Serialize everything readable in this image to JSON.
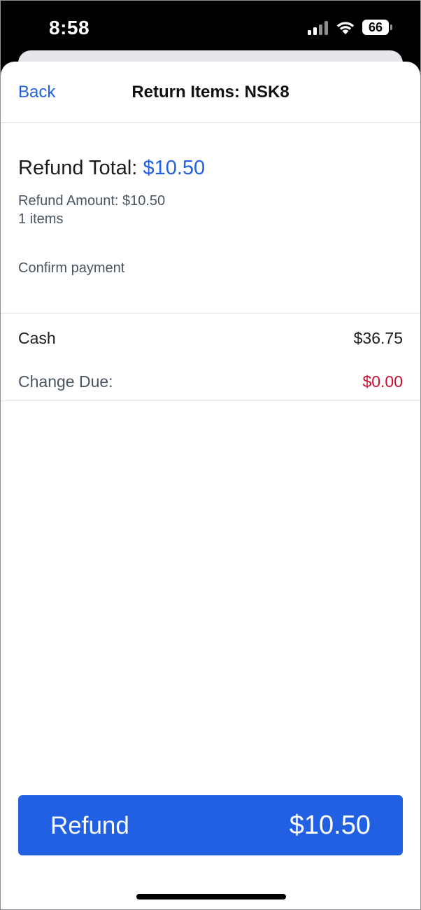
{
  "status_bar": {
    "time": "8:58",
    "battery": "66"
  },
  "nav": {
    "back_label": "Back",
    "title": "Return Items: NSK8"
  },
  "summary": {
    "refund_total_label": "Refund Total:",
    "refund_total_amount": "$10.50",
    "refund_amount": "Refund Amount: $10.50",
    "items": "1 items",
    "confirm_payment": "Confirm payment"
  },
  "payment": {
    "method_label": "Cash",
    "method_amount": "$36.75",
    "change_label": "Change Due:",
    "change_amount": "$0.00"
  },
  "refund_button": {
    "label": "Refund",
    "amount": "$10.50"
  },
  "colors": {
    "accent": "#2260e3",
    "change_due": "#c8102e"
  },
  "icons": [
    "signal-icon",
    "wifi-icon",
    "battery-icon"
  ]
}
